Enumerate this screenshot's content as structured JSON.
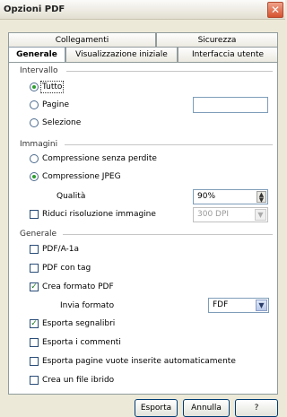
{
  "window": {
    "title": "Opzioni PDF",
    "close_glyph": "✕"
  },
  "tabs": {
    "top": [
      "Collegamenti",
      "Sicurezza"
    ],
    "bottom": [
      "Generale",
      "Visualizzazione iniziale",
      "Interfaccia utente"
    ],
    "active": "Generale"
  },
  "range": {
    "section": "Intervallo",
    "all_label": "Tutto",
    "pages_label": "Pagine",
    "pages_value": "",
    "selection_label": "Selezione"
  },
  "images": {
    "section": "Immagini",
    "lossless_label": "Compressione senza perdite",
    "jpeg_label": "Compressione JPEG",
    "quality_label": "Qualità",
    "quality_value": "90%",
    "reduce_label": "Riduci risoluzione immagine",
    "reduce_value": "300 DPI"
  },
  "general": {
    "section": "Generale",
    "pdfa_label": "PDF/A-1a",
    "tagged_label": "PDF con tag",
    "form_label": "Crea formato PDF",
    "send_format_label": "Invia formato",
    "send_format_value": "FDF",
    "bookmarks_label": "Esporta segnalibri",
    "comments_label": "Esporta i commenti",
    "blank_pages_label": "Esporta pagine vuote inserite automaticamente",
    "hybrid_label": "Crea un file ibrido"
  },
  "buttons": {
    "export": "Esporta",
    "cancel": "Annulla",
    "help": "?"
  },
  "colors": {
    "dialog_bg": "#ece9d8",
    "close_red": "#d6532f",
    "check_green": "#2f9e2f"
  }
}
